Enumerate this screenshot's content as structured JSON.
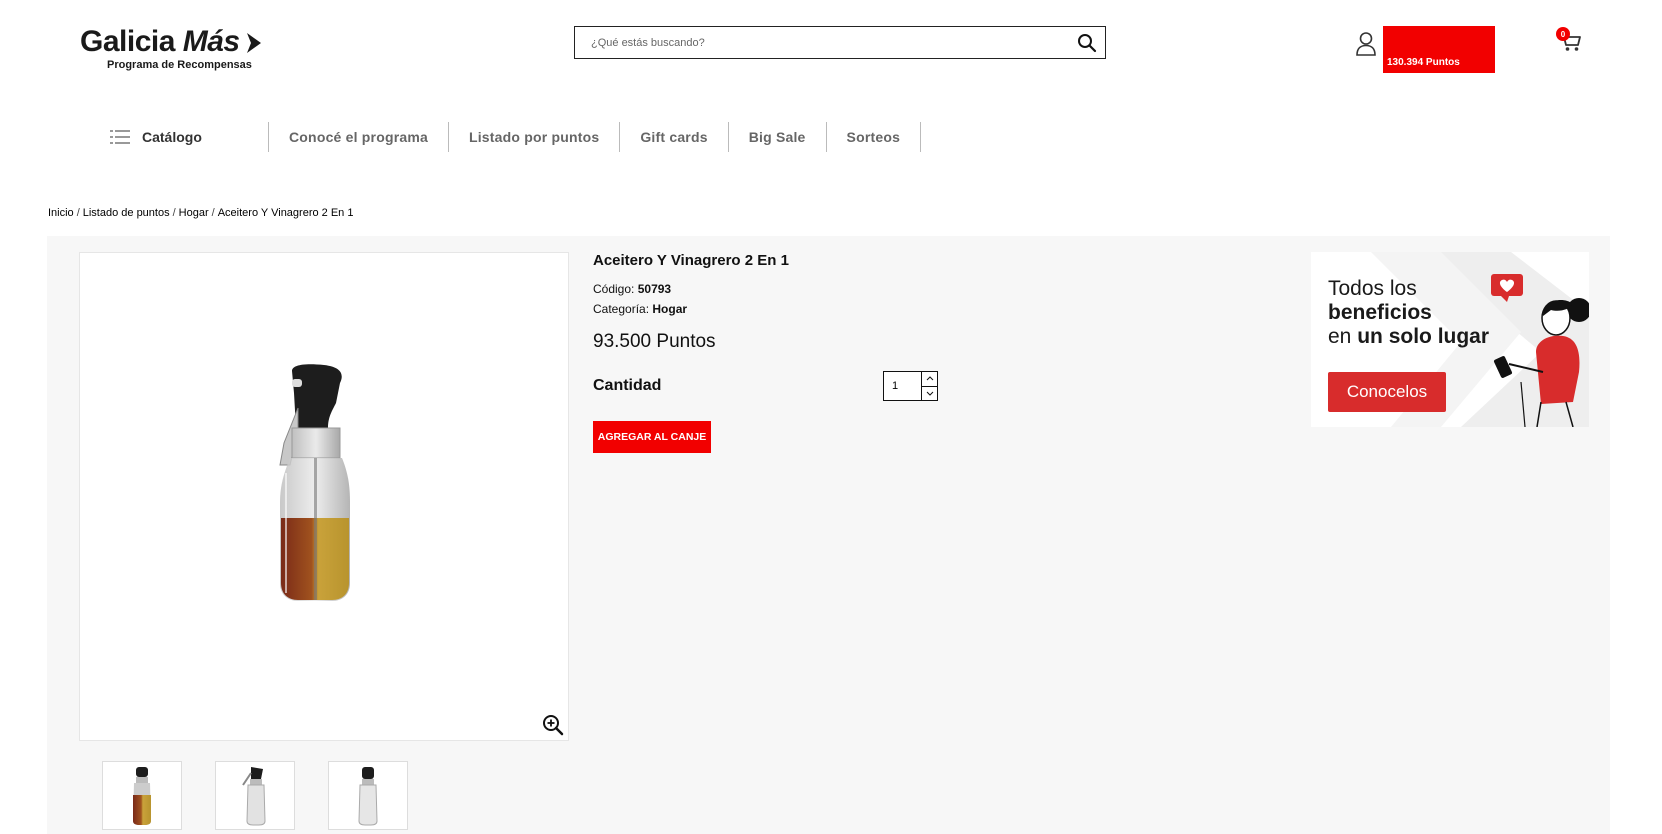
{
  "brand": {
    "title_main": "Galicia ",
    "title_mas": "Más",
    "subtitle": "Programa de Recompensas",
    "accent_color": "#f20000"
  },
  "search": {
    "placeholder": "¿Qué estás buscando?",
    "icon": "search-icon"
  },
  "account": {
    "icon": "user-icon",
    "points": "130.394 Puntos"
  },
  "cart": {
    "icon": "cart-icon",
    "count": "0"
  },
  "nav": {
    "catalog_label": "Catálogo",
    "items": [
      "Conocé el programa",
      "Listado por puntos",
      "Gift cards",
      "Big Sale",
      "Sorteos"
    ]
  },
  "breadcrumb": [
    "Inicio",
    "Listado de puntos",
    "Hogar",
    "Aceitero Y Vinagrero 2 En 1"
  ],
  "product": {
    "title": "Aceitero Y Vinagrero 2 En 1",
    "code_label": "Código:",
    "code": "50793",
    "category_label": "Categoría:",
    "category": "Hogar",
    "price": "93.500 Puntos",
    "quantity_label": "Cantidad",
    "quantity": "1",
    "add_button": "AGREGAR AL CANJE"
  },
  "banner": {
    "line1": "Todos los",
    "line2_bold": "beneficios",
    "line3_pre": "en ",
    "line3_bold": "un solo lugar",
    "button": "Conocelos"
  }
}
